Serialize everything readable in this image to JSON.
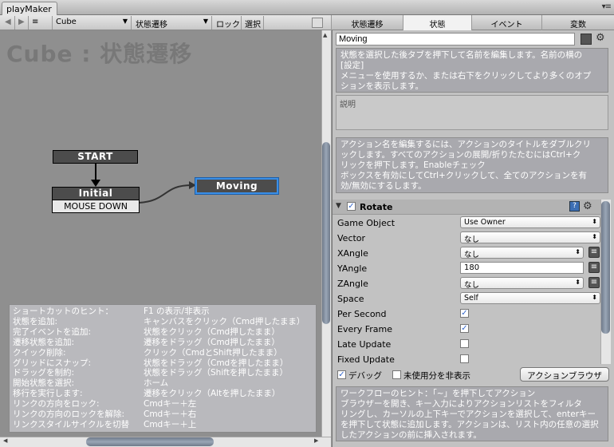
{
  "window": {
    "tab_title": "playMaker",
    "menu_glyph": "▾≡"
  },
  "toolbar": {
    "back": "◀",
    "forward": "▶",
    "menu": "≡",
    "fsm_select": "Cube",
    "state_select": "状態遷移",
    "lock": "ロック",
    "select": "選択"
  },
  "canvas": {
    "title": "Cube : 状態遷移",
    "start_label": "START",
    "states": [
      {
        "name": "Initial",
        "event": "MOUSE DOWN"
      },
      {
        "name": "Moving"
      }
    ]
  },
  "hints": {
    "rows": [
      [
        "ショートカットのヒント：",
        "F1 の表示/非表示"
      ],
      [
        "状態を追加:",
        "キャンバスをクリック（Cmd押したまま）"
      ],
      [
        "完了イベントを追加:",
        "状態をクリック（Cmd押したまま）"
      ],
      [
        "遷移状態を追加:",
        "遷移をドラッグ（Cmd押したまま）"
      ],
      [
        "クイック削除:",
        "クリック（CmdとShift押したまま）"
      ],
      [
        "グリッドにスナップ:",
        "状態をドラッグ（Cmdを押したまま）"
      ],
      [
        "ドラッグを制約:",
        "状態をドラッグ（Shiftを押したまま）"
      ],
      [
        " 開始状態を選択:",
        "ホーム"
      ],
      [
        "移行を実行します:",
        "遷移をクリック（Altを押したまま）"
      ],
      [
        "リンクの方向をロック:",
        "Cmdキー＋左"
      ],
      [
        "リンクの方向のロックを解除:",
        "Cmdキー＋右"
      ],
      [
        "リンクスタイルサイクルを切替",
        "Cmdキー＋上"
      ]
    ]
  },
  "right_tabs": [
    "状態遷移",
    "状態",
    "イベント",
    "変数"
  ],
  "state": {
    "name": "Moving",
    "help_lines": [
      "状態を選択した後タブを押下して名前を編集します。名前の横の",
      "[設定]",
      "メニューを使用するか、または右下をクリックしてより多くのオプ",
      "ションを表示します。"
    ],
    "description_placeholder": "説明",
    "action_help_lines": [
      "アクション名を編集するには、アクションのタイトルをダブルクリ",
      "ックします。すべてのアクションの展開/折りたたむにはCtrl+ク",
      "リックを押下します。Enableチェック",
      "ボックスを有効にしてCtrl+クリックして、全てのアクションを有",
      "効/無効にするします。"
    ]
  },
  "action": {
    "name": "Rotate",
    "enabled": true,
    "help_glyph": "?",
    "properties": [
      {
        "label": "Game Object",
        "kind": "dropdown",
        "value": "Use Owner"
      },
      {
        "label": "Vector",
        "kind": "dropdown",
        "value": "なし"
      },
      {
        "label": "XAngle",
        "kind": "dropdown_eq",
        "value": "なし"
      },
      {
        "label": "YAngle",
        "kind": "text_eq",
        "value": "180"
      },
      {
        "label": "ZAngle",
        "kind": "dropdown_eq",
        "value": "なし"
      },
      {
        "label": "Space",
        "kind": "dropdown",
        "value": "Self"
      },
      {
        "label": "Per Second",
        "kind": "check",
        "checked": true
      },
      {
        "label": "Every Frame",
        "kind": "check",
        "checked": true
      },
      {
        "label": "Late Update",
        "kind": "check",
        "checked": false
      },
      {
        "label": "Fixed Update",
        "kind": "check",
        "checked": false
      }
    ]
  },
  "bottom": {
    "debug_label": "デバッグ",
    "debug_checked": true,
    "hide_unused_label": "未使用分を非表示",
    "hide_unused_checked": false,
    "browser_button": "アクションブラウザ",
    "workflow_lines": [
      "ワークフローのヒント：「~」を押下してアクション",
      "ブラウザーを開き、キー入力によりアクションリストをフィルタ",
      "リングし、カーソルの上下キーでアクションを選択して、enterキー",
      "を押下して状態に追加します。アクションは、リスト内の任意の選択",
      "したアクションの前に挿入されます。"
    ]
  },
  "colors": {
    "selected_state_border": "#3a8ee6",
    "state_color": "#555555"
  }
}
